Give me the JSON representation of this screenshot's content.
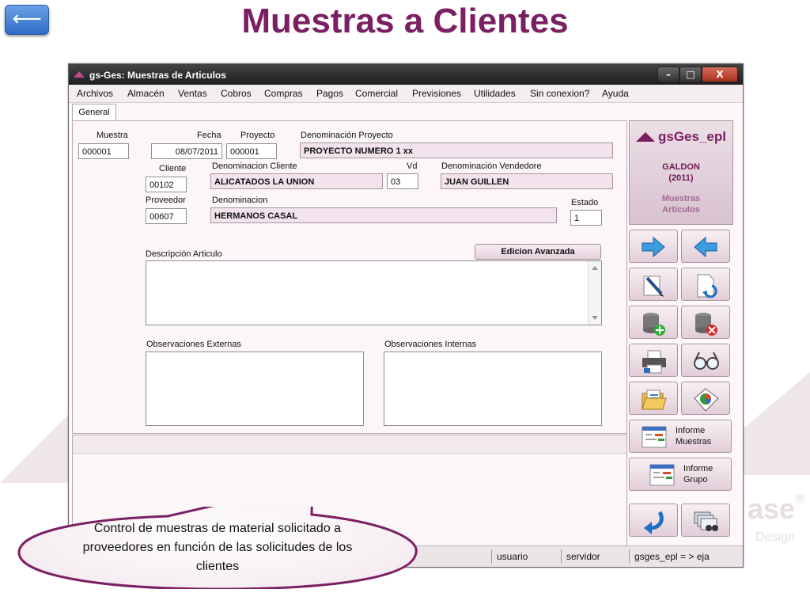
{
  "slide": {
    "title": "Muestras a Clientes",
    "back_glyph": "⟵",
    "watermark_text": "ase",
    "watermark_reg": "®",
    "watermark_sub": "Design"
  },
  "window": {
    "title": "gs-Ges: Muestras de Articulos",
    "controls": {
      "minimize": "–",
      "maximize": "□",
      "close": "X"
    }
  },
  "menu": [
    "Archivos",
    "Almacén",
    "Ventas",
    "Cobros",
    "Compras",
    "Pagos",
    "Comercial",
    "Previsiones",
    "Utilidades",
    "Sin conexion?",
    "Ayuda"
  ],
  "tab": "General",
  "form": {
    "muestra": {
      "label": "Muestra",
      "value": "000001"
    },
    "fecha": {
      "label": "Fecha",
      "value": "08/07/2011"
    },
    "proyecto": {
      "label": "Proyecto",
      "value": "000001"
    },
    "denom_proyecto": {
      "label": "Denominación Proyecto",
      "value": "PROYECTO NUMERO 1 xx"
    },
    "cliente": {
      "label": "Cliente",
      "value": "00102"
    },
    "denom_cliente": {
      "label": "Denominacion Cliente",
      "value": "ALICATADOS LA UNION"
    },
    "vd": {
      "label": "Vd",
      "value": "03"
    },
    "denom_vendedor": {
      "label": "Denominación Vendedore",
      "value": "JUAN GUILLEN"
    },
    "proveedor": {
      "label": "Proveedor",
      "value": "00607"
    },
    "denom_proveedor": {
      "label": "Denominacion",
      "value": "HERMANOS CASAL"
    },
    "estado": {
      "label": "Estado",
      "value": "1"
    },
    "descripcion_label": "Descripción Articulo",
    "edicion_button": "Edicion Avanzada",
    "obs_ext_label": "Observaciones Externas",
    "obs_int_label": "Observaciones Internas"
  },
  "brand": {
    "name": "gsGes_epl",
    "line1": "GALDON",
    "line2": "(2011)",
    "sub1": "Muestras",
    "sub2": "Articulos"
  },
  "toolbar": {
    "informe_muestras": [
      "Informe",
      "Muestras"
    ],
    "informe_grupo": [
      "Informe",
      "Grupo"
    ]
  },
  "status": {
    "usuario": "usuario",
    "servidor": "servidor",
    "conexion": "gsges_epl = > eja"
  },
  "callout": "Control de muestras de material solicitado a proveedores en función de las solicitudes de los clientes",
  "colors": {
    "title": "#7b1f63",
    "accent": "#7b1f63",
    "field_pink": "#f2e3ec",
    "window_bg": "#fdf7f9"
  }
}
